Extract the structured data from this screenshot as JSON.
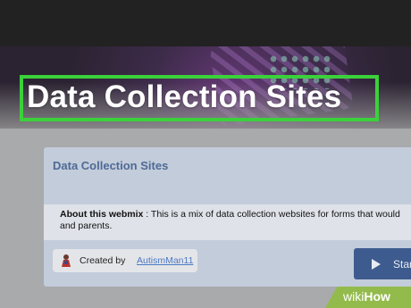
{
  "banner": {
    "title": "Data Collection Sites"
  },
  "panel": {
    "title": "Data Collection Sites",
    "about_label": "About this webmix",
    "about_text": " : This is a mix of data collection websites for forms that would",
    "about_text_line2": "and parents.",
    "creator_prefix": "Created by",
    "creator_name": "AutismMan11",
    "start_label": "Start"
  },
  "watermark": {
    "wiki": "wiki",
    "how": "How"
  },
  "colors": {
    "highlight": "#3bd13b",
    "panel_title": "#4e6a96",
    "link": "#4d79c4",
    "start_button": "#3d5b8e",
    "wikihow_green": "#93bb4c"
  }
}
